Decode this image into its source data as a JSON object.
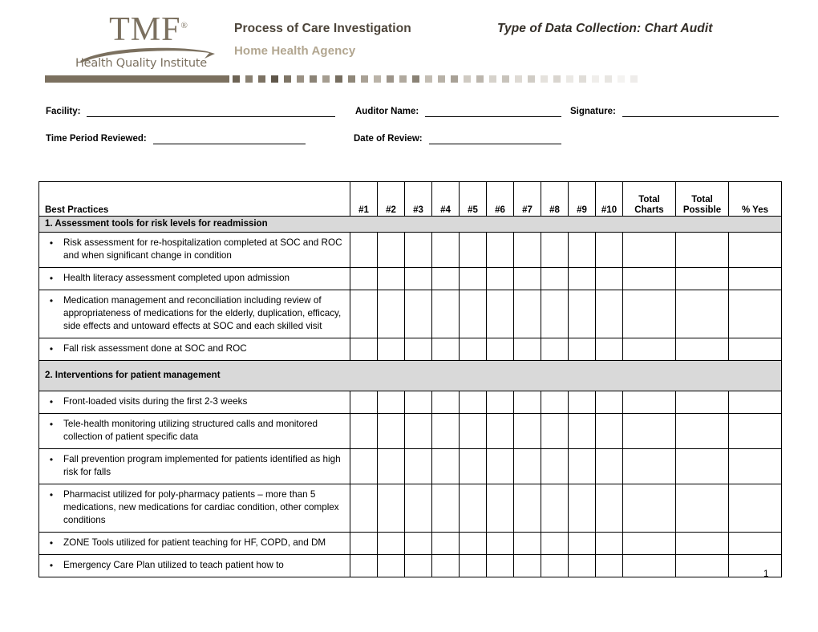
{
  "header": {
    "logo": {
      "wordmark": "TMF",
      "trademark": "®",
      "tagline": "Health Quality Institute",
      "color": "#7b705f"
    },
    "title_main": "Process of Care Investigation",
    "title_sub": "Home Health Agency",
    "title_right": "Type of Data Collection: Chart Audit",
    "accent_color": "#7b705f",
    "sub_color": "#b2a690"
  },
  "form": {
    "rows": [
      [
        {
          "label": "Facility:",
          "value": "",
          "line_width": 310
        },
        {
          "label": "Auditor Name:",
          "value": "",
          "line_width": 170
        },
        {
          "label": "Signature:",
          "value": "",
          "line_width": 195
        }
      ],
      [
        {
          "label": "Time Period Reviewed:",
          "value": "",
          "line_width": 190
        },
        {
          "label": "Date of Review:",
          "value": "",
          "line_width": 165
        }
      ]
    ]
  },
  "table": {
    "headers": {
      "practice": "Best Practices",
      "charts": [
        "#1",
        "#2",
        "#3",
        "#4",
        "#5",
        "#6",
        "#7",
        "#8",
        "#9",
        "#10"
      ],
      "total_charts": "Total\nCharts",
      "total_charts_l1": "Total",
      "total_charts_l2": "Charts",
      "total_possible_l1": "Total",
      "total_possible_l2": "Possible",
      "percent_yes": "% Yes"
    },
    "sections": [
      {
        "title": "1. Assessment tools for risk levels for readmission",
        "tall": false,
        "leading_blank": false,
        "items": [
          "Risk assessment for re-hospitalization completed at SOC and ROC and when significant change in condition",
          "Health literacy assessment completed upon admission",
          "Medication management and reconciliation including review of appropriateness of medications for the elderly, duplication, efficacy, side effects and untoward effects at SOC and each skilled visit",
          "Fall risk assessment done at SOC and ROC"
        ]
      },
      {
        "title": "2. Interventions for patient management",
        "tall": true,
        "leading_blank": false,
        "items": [
          "Front-loaded visits during the first 2-3 weeks",
          "Tele-health monitoring utilizing structured calls and monitored collection of patient specific data",
          "Fall prevention program implemented for patients identified as high risk for falls",
          "Pharmacist utilized for poly-pharmacy patients – more than 5 medications, new medications for cardiac condition, other complex conditions",
          "ZONE Tools utilized for patient teaching for HF, COPD, and DM",
          "Emergency Care Plan utilized to teach patient how to"
        ]
      }
    ],
    "bullet_glyph": "•",
    "section_bg": "#d9d9d9"
  },
  "footer": {
    "page_number": "1"
  },
  "decor": {
    "bar_color": "#7b705f",
    "dot_colors": [
      "#6d6354",
      "#8a8172",
      "#7c7263",
      "#5f564a",
      "#7e7566",
      "#9a9184",
      "#8b8376",
      "#a59d90",
      "#776e60",
      "#8f8779",
      "#a9a195",
      "#bab3a8",
      "#9d958a",
      "#b0a99e",
      "#8a8275",
      "#c3bdb3",
      "#b7b1a7",
      "#a8a196",
      "#cfcac2",
      "#bcb6ad",
      "#d6d2cb",
      "#c8c3bb",
      "#dedad4",
      "#d0ccc5",
      "#e5e2dd",
      "#d9d5cf",
      "#ebe9e5",
      "#e0ddd8",
      "#f0eeeb",
      "#e8e6e2",
      "#f4f3f1",
      "#eeecea"
    ]
  }
}
